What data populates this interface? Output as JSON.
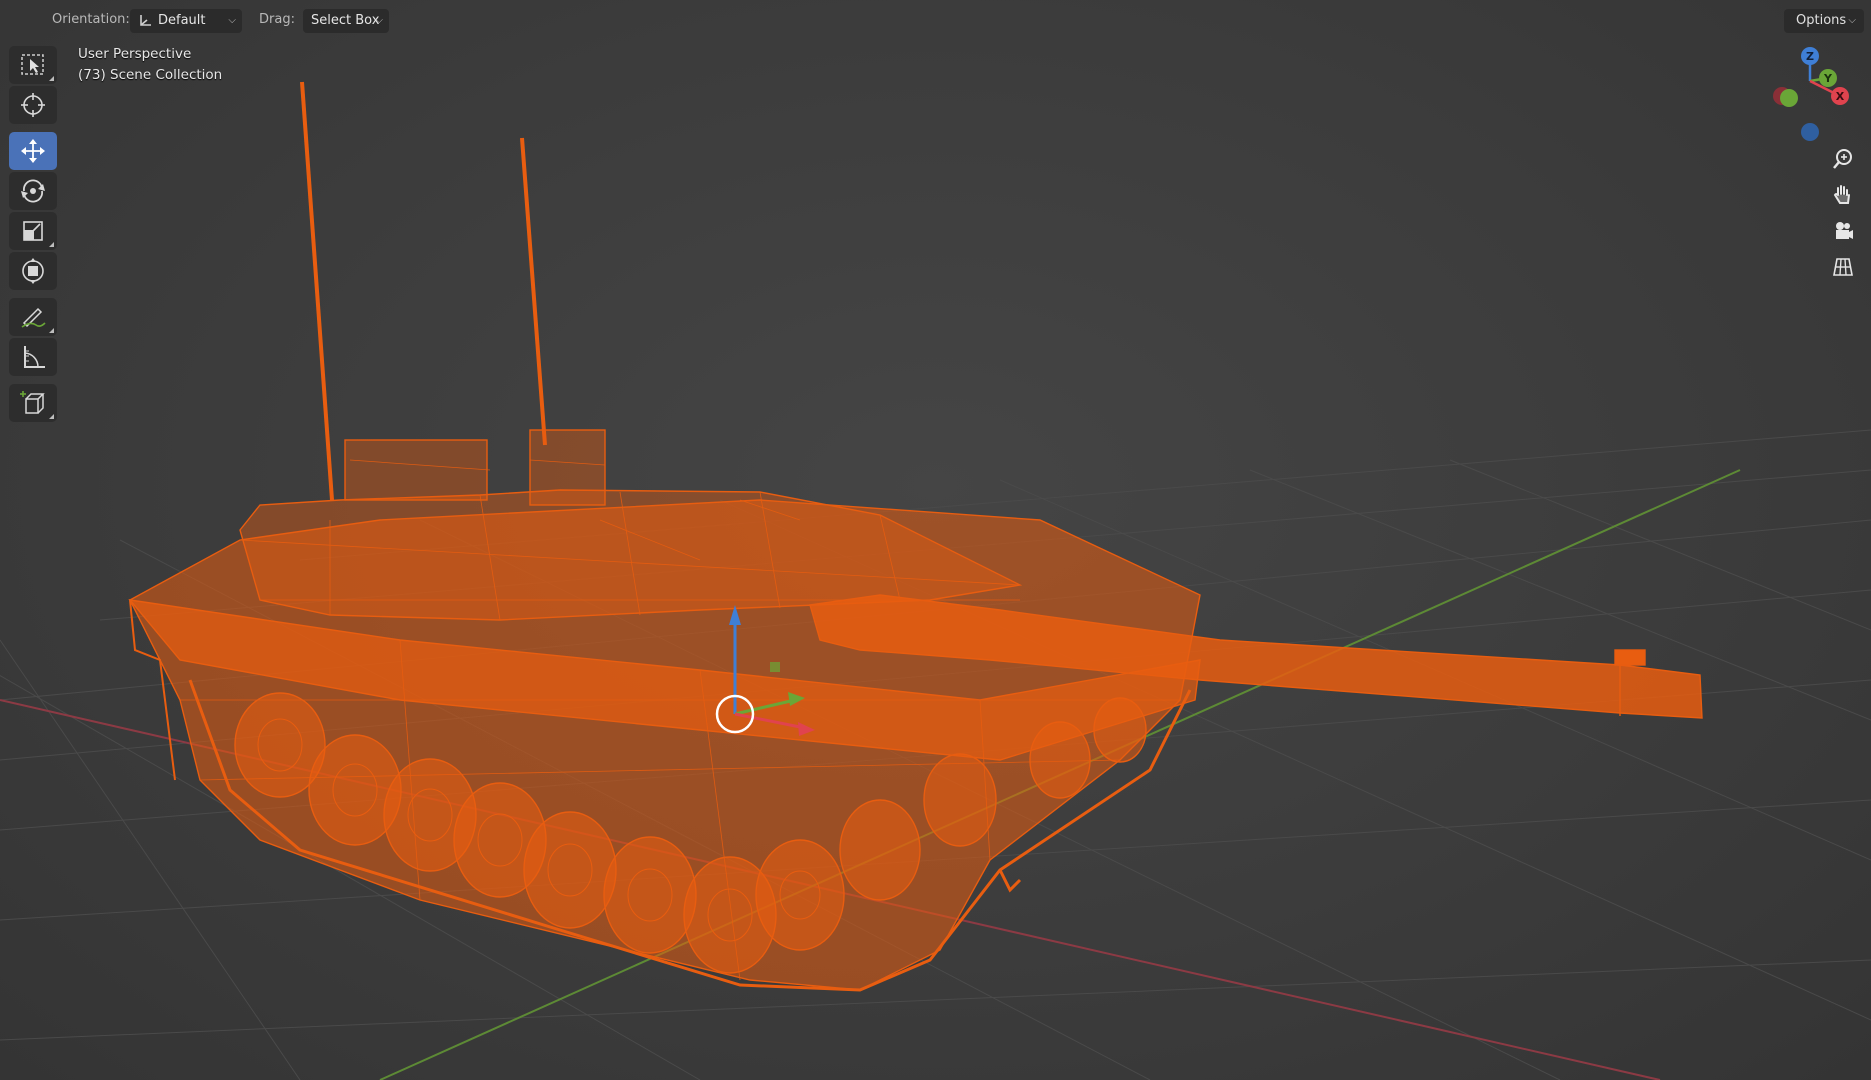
{
  "header": {
    "orientation_label": "Orientation:",
    "orientation_value": "Default",
    "drag_label": "Drag:",
    "drag_value": "Select Box",
    "options_label": "Options"
  },
  "viewport": {
    "view_name": "User Perspective",
    "collection_info": "(73) Scene Collection"
  },
  "toolbar": {
    "tools": [
      {
        "name": "select-box",
        "icon": "select-box-icon",
        "active": false
      },
      {
        "name": "cursor",
        "icon": "cursor-icon",
        "active": false
      },
      {
        "name": "move",
        "icon": "move-icon",
        "active": true
      },
      {
        "name": "rotate",
        "icon": "rotate-icon",
        "active": false
      },
      {
        "name": "scale",
        "icon": "scale-icon",
        "active": false
      },
      {
        "name": "transform",
        "icon": "transform-icon",
        "active": false
      },
      {
        "name": "annotate",
        "icon": "annotate-icon",
        "active": false
      },
      {
        "name": "measure",
        "icon": "measure-icon",
        "active": false
      },
      {
        "name": "add-cube",
        "icon": "add-cube-icon",
        "active": false
      }
    ]
  },
  "gizmo": {
    "axes": [
      "Z",
      "Y",
      "X"
    ],
    "colors": {
      "x": "#e0434e",
      "y": "#6aa637",
      "z": "#3f7fd6"
    }
  },
  "navigation": {
    "buttons": [
      "zoom-icon",
      "pan-hand-icon",
      "camera-icon",
      "grid-icon"
    ]
  },
  "colors": {
    "selection": "#e85d10",
    "background": "#3d3d3d",
    "active_tool": "#4a72b8",
    "x_axis_line": "#8c3a44",
    "y_axis_line": "#5d8a35"
  }
}
